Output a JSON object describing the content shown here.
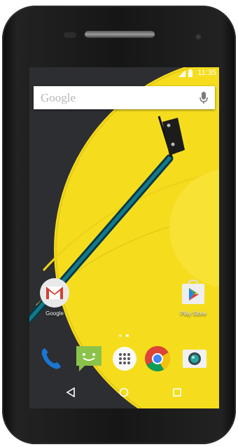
{
  "status_bar": {
    "time": "11:35"
  },
  "search": {
    "placeholder": "Google"
  },
  "home_apps": [
    {
      "label": "Google",
      "icon": "gmail-icon"
    },
    {
      "label": "Play Store",
      "icon": "play-store-icon"
    }
  ],
  "dock": [
    {
      "icon": "phone-icon"
    },
    {
      "icon": "messaging-icon"
    },
    {
      "icon": "app-drawer-icon"
    },
    {
      "icon": "chrome-icon"
    },
    {
      "icon": "camera-icon"
    }
  ],
  "navigation": {
    "back": "back-icon",
    "home": "home-icon",
    "recents": "recents-icon"
  },
  "colors": {
    "wallpaper_yellow": "#f5dd1e",
    "wallpaper_dark": "#2d2e31",
    "tonearm": "#0d5a6a"
  }
}
